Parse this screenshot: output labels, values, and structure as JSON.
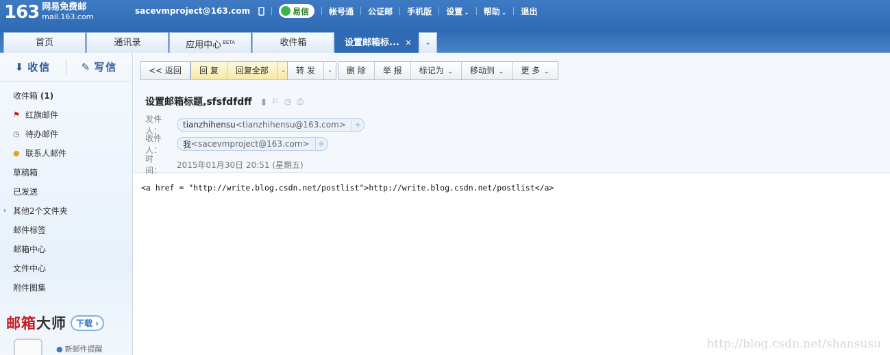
{
  "header": {
    "logo_num": "163",
    "logo_cn": "网易免费邮",
    "logo_domain": "mail.163.com",
    "email": "sacevmproject@163.com",
    "yixin": "易信",
    "links": {
      "account": "帐号通",
      "notary": "公证邮",
      "mobile": "手机版",
      "settings": "设置",
      "help": "帮助",
      "logout": "退出"
    }
  },
  "tabs": {
    "home": "首页",
    "contacts": "通讯录",
    "apps": "应用中心",
    "apps_badge": "BETA",
    "inbox": "收件箱",
    "active": "设置邮箱标...",
    "close": "×",
    "more": "⌄"
  },
  "sidebar": {
    "receive": "收信",
    "write": "写信",
    "folders": {
      "inbox": "收件箱",
      "inbox_count": "(1)",
      "flagged": "红旗邮件",
      "todo": "待办邮件",
      "contacts_mail": "联系人邮件",
      "drafts": "草稿箱",
      "sent": "已发送",
      "others": "其他2个文件夹",
      "tags": "邮件标签",
      "mailbox_center": "邮箱中心",
      "file_center": "文件中心",
      "attachments": "附件图集"
    },
    "promo": {
      "title_red": "邮箱",
      "title_dark": "大师",
      "button": "下载",
      "tip": "新邮件提醒"
    }
  },
  "toolbar": {
    "back": "<< 返回",
    "reply": "回 复",
    "reply_all": "回复全部",
    "forward": "转 发",
    "delete": "删 除",
    "report": "举 报",
    "mark_as": "标记为",
    "move_to": "移动到",
    "more": "更 多"
  },
  "message": {
    "subject": "设置邮箱标题,sfsfdfdff",
    "from_label": "发件人：",
    "from_name": "tianzhihensu",
    "from_addr": "<tianzhihensu@163.com>",
    "to_label": "收件人：",
    "to_name": "我",
    "to_addr": "<sacevmproject@163.com>",
    "time_label": "时　间：",
    "time_value": "2015年01月30日 20:51 (星期五)",
    "body": "<a href = \"http://write.blog.csdn.net/postlist\">http://write.blog.csdn.net/postlist</a>"
  },
  "watermark": "http://blog.csdn.net/shansusu"
}
